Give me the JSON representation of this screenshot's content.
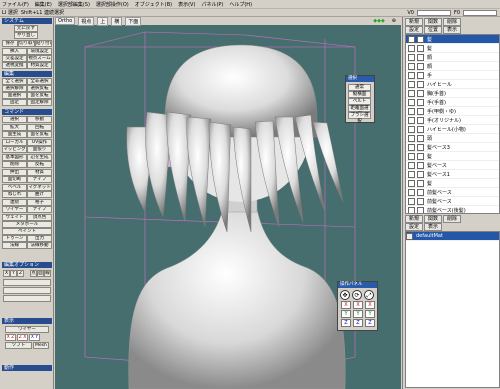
{
  "menu": [
    "ファイル(F)",
    "編集(E)",
    "選択部編集(S)",
    "選択部操作(O)",
    "オブジェクト(B)",
    "表示(V)",
    "パネル(P)",
    "ヘルプ(H)"
  ],
  "toolbar": {
    "items": [
      "LI 選択",
      "Shift+L1 連続選択"
    ],
    "v_label": "V0",
    "f_label": "F0"
  },
  "viewport_tabs": [
    "Ortho",
    "視点",
    "上",
    "横",
    "下面"
  ],
  "left_panel": {
    "system_title": "システム",
    "system_buttons": [
      "元に戻す",
      "やり直し",
      "保存",
      "切り取り",
      "貼り付け",
      "挿入",
      "環境設定",
      "交差設定",
      "視点ズーム",
      "透視変換",
      "材質設定"
    ],
    "edit_title": "編集",
    "edit_buttons": [
      "全て選択",
      "全非選択",
      "選択解除",
      "選択反転",
      "面選択",
      "面を反転",
      "固定",
      "固定解除"
    ],
    "command_title": "コマンド",
    "command_buttons": [
      "選択",
      "移動",
      "拡大",
      "回転",
      "面生成",
      "面を反転",
      "ローカル",
      "UV操作",
      "マッピング",
      "面張り",
      "基本図形",
      "辺を生成",
      "削除",
      "反転",
      "押出",
      "材質",
      "面切断",
      "ナイフ",
      "ベベル",
      "マグネット",
      "ねじれ",
      "曲げ",
      "連続",
      "格子",
      "ワイヤー",
      "ナイフ",
      "ウェイト",
      "頂点色"
    ],
    "extra_buttons": [
      "メタボール",
      "ペイント",
      "トゥーン",
      "出力",
      "法線",
      "法線移動"
    ],
    "option_title": "編集オプション",
    "option_buttons": [
      "X",
      "Y",
      "Z",
      "点",
      "面",
      "線"
    ],
    "display_title": "表示",
    "display_buttons": [
      "ワイヤー",
      "X Z",
      "Z X",
      "X Y",
      "ソフト",
      "Mesh"
    ],
    "panel_title": "動作"
  },
  "select_popup": {
    "title": "選択",
    "buttons": [
      "通常",
      "縦横面",
      "ベルト",
      "距離面選択",
      "ブラシ選択"
    ]
  },
  "op_panel": {
    "title": "操作パネル",
    "rows": [
      [
        "X",
        "X",
        "X"
      ],
      [
        "Y",
        "Y",
        "Y"
      ],
      [
        "Z",
        "Z",
        "Z"
      ]
    ]
  },
  "right_panel": {
    "top_tabs": [
      "新規",
      "関数",
      "削除"
    ],
    "sub_tabs": [
      "設定",
      "位置",
      "表示"
    ],
    "objects": [
      "髪",
      "髪",
      "顔",
      "顔",
      "手",
      "ハイヒール",
      "胸(手首)",
      "手(手首)",
      "手(甲側・ゆ)",
      "手(オリジナル)",
      "ハイヒール(小物)",
      "頭",
      "髪ベース3",
      "髪",
      "髪ベース",
      "髪ベース1",
      "髪",
      "前髪ベース",
      "前髪ベース",
      "前髪ベース(後髪)",
      "前髪センター",
      "前髪"
    ],
    "material_tabs": [
      "新規",
      "関数",
      "削除"
    ],
    "material_sub": [
      "設定",
      "表示"
    ],
    "materials": [
      "defaultMat"
    ]
  },
  "colors": {
    "viewport_bg": "#466e6e",
    "accent": "#274d8f",
    "selection": "#2457a8"
  }
}
